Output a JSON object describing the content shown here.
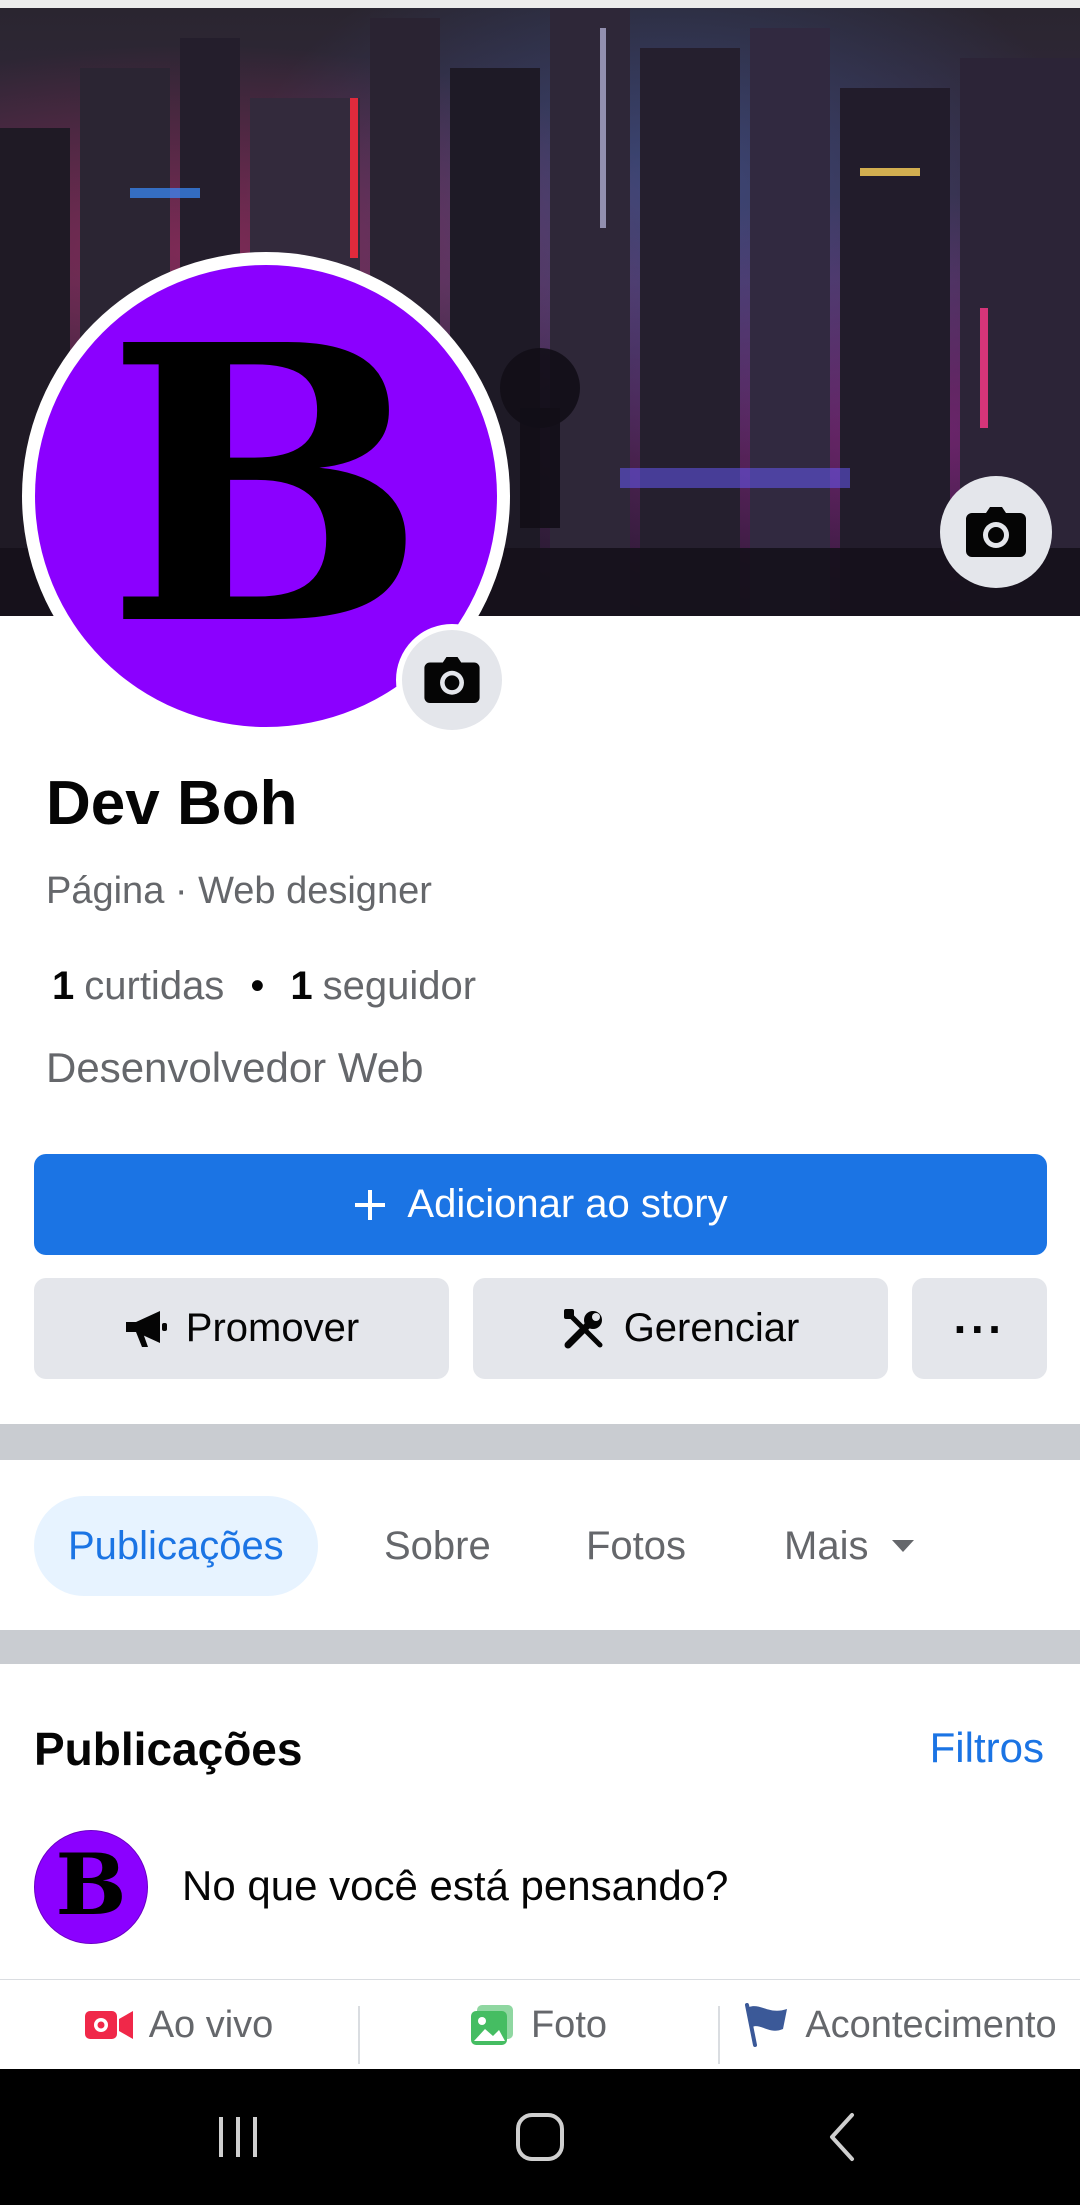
{
  "profile": {
    "name": "Dev Boh",
    "category": "Página · Web designer",
    "likes_count": "1",
    "likes_label": "curtidas",
    "followers_count": "1",
    "followers_label": "seguidor",
    "stats_separator": "•",
    "bio": "Desenvolvedor Web",
    "avatar_letter": "B",
    "avatar_color": "#8b00ff"
  },
  "buttons": {
    "add_story": "Adicionar ao story",
    "promote": "Promover",
    "manage": "Gerenciar",
    "more": "···"
  },
  "tabs": {
    "posts": "Publicações",
    "about": "Sobre",
    "photos": "Fotos",
    "more": "Mais"
  },
  "posts_section": {
    "title": "Publicações",
    "filters": "Filtros",
    "composer_placeholder": "No que você está pensando?",
    "composer_avatar_letter": "B"
  },
  "post_actions": {
    "live": "Ao vivo",
    "photo": "Foto",
    "event": "Acontecimento"
  },
  "icons": {
    "cover_camera": "camera-icon",
    "avatar_camera": "camera-icon",
    "add": "plus-icon",
    "promote": "megaphone-icon",
    "manage": "tools-icon",
    "more_tabs": "caret-down-icon",
    "live": "video-camera-icon",
    "photo": "photo-icon",
    "event": "flag-icon"
  },
  "colors": {
    "primary_blue": "#1b74e4",
    "gray_button": "#e4e6eb",
    "secondary_text": "#65676b",
    "live_red": "#f02849",
    "photo_green": "#45bd62",
    "event_blue": "#3b5998"
  }
}
